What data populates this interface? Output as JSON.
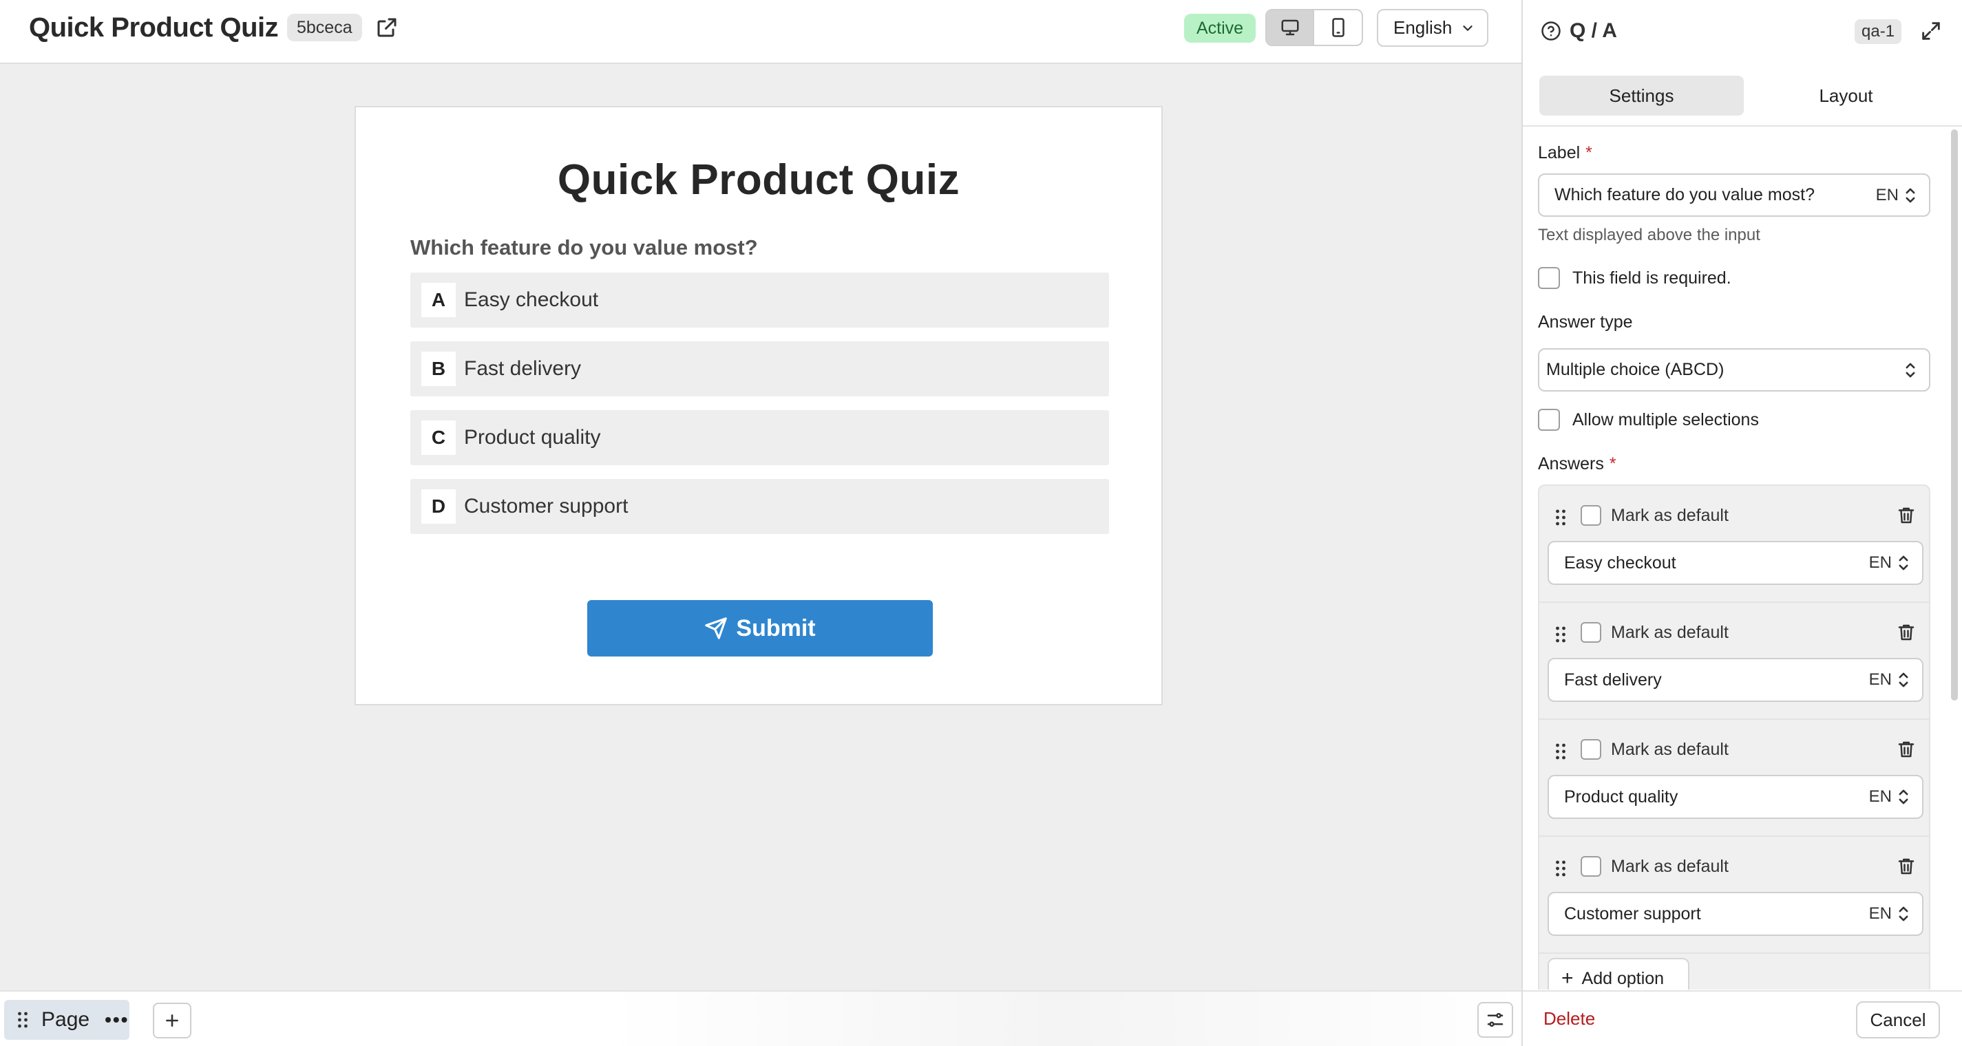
{
  "header": {
    "title": "Quick Product Quiz",
    "hash": "5bceca",
    "status": "Active",
    "language": "English"
  },
  "form": {
    "title": "Quick Product Quiz",
    "question": "Which feature do you value most?",
    "answers": [
      {
        "letter": "A",
        "text": "Easy checkout"
      },
      {
        "letter": "B",
        "text": "Fast delivery"
      },
      {
        "letter": "C",
        "text": "Product quality"
      },
      {
        "letter": "D",
        "text": "Customer support"
      }
    ],
    "submit_label": "Submit",
    "accent_color": "#2f86cf"
  },
  "bottom_bar": {
    "page_label": "Page",
    "more_label": "•••"
  },
  "panel": {
    "title": "Q / A",
    "id": "qa-1",
    "tabs": [
      {
        "label": "Settings",
        "active": true
      },
      {
        "label": "Layout",
        "active": false
      }
    ],
    "label_field": {
      "label": "Label",
      "required_marker": "*",
      "value": "Which feature do you value most?",
      "lang": "EN",
      "help": "Text displayed above the input"
    },
    "required_checkbox": {
      "label": "This field is required.",
      "checked": false
    },
    "answer_type": {
      "label": "Answer type",
      "value": "Multiple choice (ABCD)"
    },
    "multiple_checkbox": {
      "label": "Allow multiple selections",
      "checked": false
    },
    "answers_section": {
      "label": "Answers",
      "required_marker": "*",
      "items": [
        {
          "default_label": "Mark as default",
          "value": "Easy checkout",
          "lang": "EN"
        },
        {
          "default_label": "Mark as default",
          "value": "Fast delivery",
          "lang": "EN"
        },
        {
          "default_label": "Mark as default",
          "value": "Product quality",
          "lang": "EN"
        },
        {
          "default_label": "Mark as default",
          "value": "Customer support",
          "lang": "EN"
        }
      ],
      "add_option_label": "Add option"
    },
    "footer": {
      "delete_label": "Delete",
      "cancel_label": "Cancel"
    }
  },
  "icons": {
    "external_link": "external-link-icon",
    "desktop": "monitor-icon",
    "mobile": "smartphone-icon",
    "chevron": "chevron-down-icon",
    "help": "question-circle-icon",
    "expand": "expand-icon",
    "drag": "grip-vertical-icon",
    "trash": "trash-icon",
    "send": "send-icon",
    "plus": "plus-icon",
    "settings": "sliders-icon"
  },
  "colors": {
    "status_bg": "#b9f1c6",
    "status_text": "#1d6b33",
    "danger": "#b71c1c",
    "canvas_bg": "#eeeeee"
  }
}
